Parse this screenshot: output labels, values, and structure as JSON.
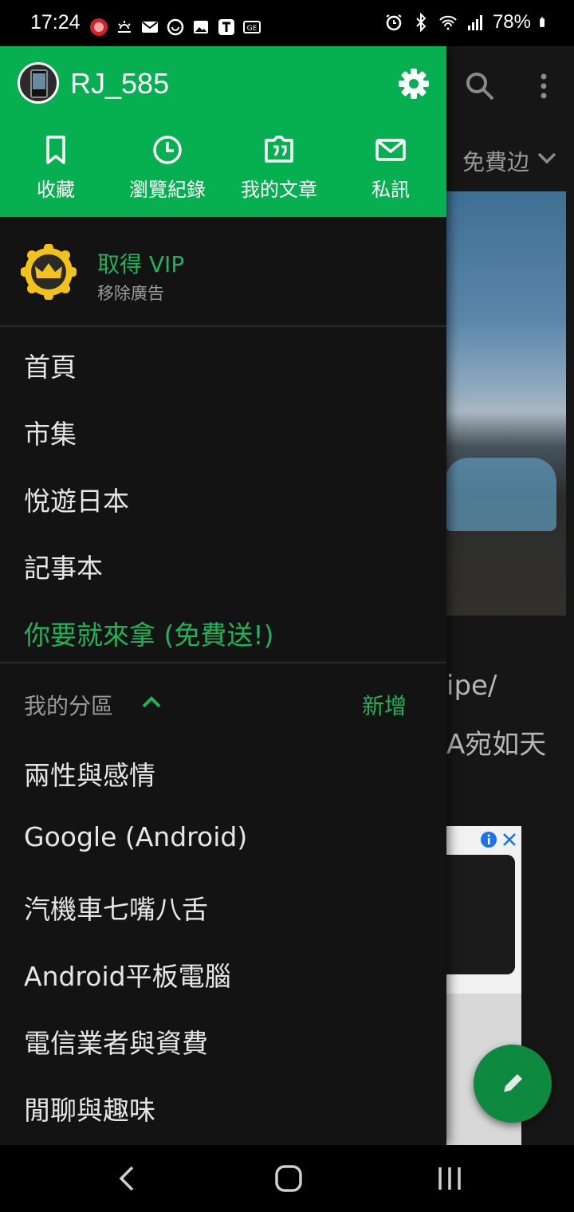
{
  "status": {
    "time": "17:24",
    "battery": "78%",
    "notification_icons": [
      "app-badge-icon",
      "weather-icon",
      "mail-icon",
      "chat-icon",
      "image-icon",
      "t-app-icon",
      "ge-icon"
    ],
    "system_icons": [
      "alarm-icon",
      "bluetooth-icon",
      "wifi-icon",
      "signal-icon",
      "battery-icon"
    ]
  },
  "colors": {
    "accent": "#06b050",
    "accent_text": "#1fb35a",
    "fab": "#0d8a3f",
    "background": "#131313"
  },
  "background_app": {
    "tab_label": "免費边",
    "title_line1": "ipe/",
    "title_line2": "A宛如天"
  },
  "drawer": {
    "username": "RJ_585",
    "quick_actions": [
      {
        "label": "收藏",
        "icon": "bookmark-icon"
      },
      {
        "label": "瀏覽紀錄",
        "icon": "clock-icon"
      },
      {
        "label": "我的文章",
        "icon": "quote-icon"
      },
      {
        "label": "私訊",
        "icon": "mail-icon"
      }
    ],
    "vip": {
      "title": "取得 VIP",
      "subtitle": "移除廣告"
    },
    "menu": [
      "首頁",
      "市集",
      "悅遊日本",
      "記事本"
    ],
    "promo": "你要就來拿 (免費送!)",
    "section": {
      "label": "我的分區",
      "add": "新增"
    },
    "boards": [
      "兩性與感情",
      "Google (Android)",
      "汽機車七嘴八舌",
      "Android平板電腦",
      "電信業者與資費",
      "閒聊與趣味"
    ]
  }
}
